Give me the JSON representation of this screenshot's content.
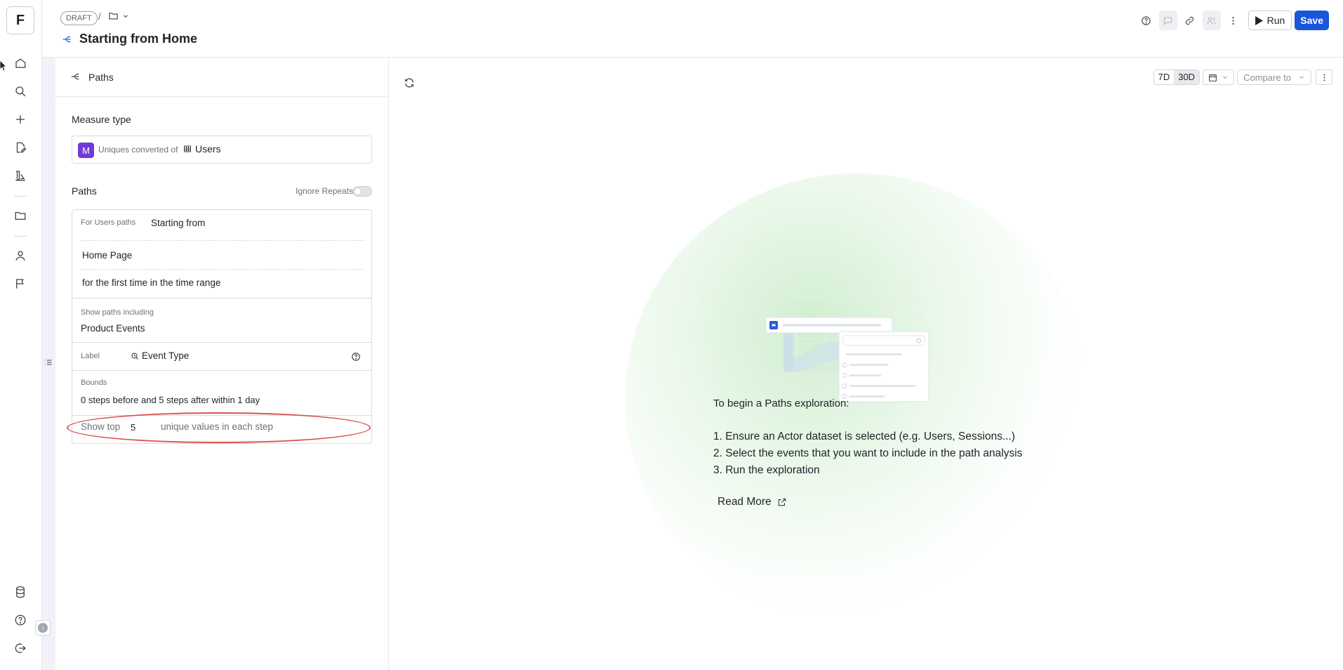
{
  "app": {
    "logo_letter": "F"
  },
  "header": {
    "draft_badge": "DRAFT",
    "separator": "/",
    "title": "Starting from Home",
    "run_label": "Run",
    "save_label": "Save"
  },
  "panel": {
    "tab_label": "Paths",
    "measure": {
      "title": "Measure type",
      "badge": "M",
      "text": "Uniques converted of",
      "dataset": "Users"
    },
    "paths": {
      "title": "Paths",
      "ignore_repeats_label": "Ignore Repeats",
      "ignore_repeats_on": false,
      "for_label": "For Users paths",
      "starting_from": "Starting from",
      "start_event": "Home Page",
      "first_time": "for the first time in the time range",
      "including_label": "Show paths including",
      "including_value": "Product Events",
      "label_label": "Label",
      "label_value": "Event Type",
      "bounds_label": "Bounds",
      "bounds_value": "0 steps before and 5 steps after within 1 day",
      "show_top_label": "Show top",
      "show_top_value": "5",
      "unique_values_label": "unique values in each step"
    }
  },
  "main": {
    "time_ranges": [
      "7D",
      "30D"
    ],
    "active_range": "30D",
    "compare_placeholder": "Compare to",
    "help_title": "To begin a Paths exploration:",
    "steps": [
      "1. Ensure an Actor dataset is selected (e.g. Users, Sessions...)",
      "2. Select the events that you want to include in the path analysis",
      "3. Run the exploration"
    ],
    "read_more": "Read More"
  },
  "colors": {
    "accent": "#1a56db",
    "measure_badge": "#6f3ad6",
    "annotation_oval": "#d9534f"
  }
}
